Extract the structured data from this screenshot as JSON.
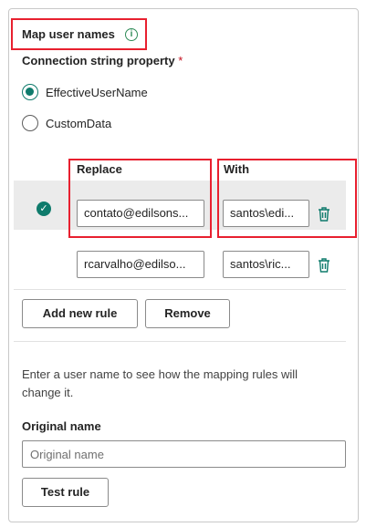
{
  "section": {
    "title": "Map user names",
    "info_icon": "info-icon"
  },
  "connection_property": {
    "label": "Connection string property",
    "required_marker": "*",
    "options": [
      {
        "label": "EffectiveUserName",
        "selected": true
      },
      {
        "label": "CustomData",
        "selected": false
      }
    ]
  },
  "rules_table": {
    "columns": {
      "replace": "Replace",
      "with": "With"
    },
    "rows": [
      {
        "replace": "contato@edilsons...",
        "with": "santos\\edi...",
        "selected": true
      },
      {
        "replace": "rcarvalho@edilso...",
        "with": "santos\\ric...",
        "selected": false
      }
    ]
  },
  "actions": {
    "add_rule": "Add new rule",
    "remove": "Remove"
  },
  "test": {
    "description": "Enter a user name to see how the mapping rules will change it.",
    "original_name_label": "Original name",
    "original_name_placeholder": "Original name",
    "original_name_value": "",
    "test_button": "Test rule"
  },
  "colors": {
    "accent": "#0f7b6c",
    "highlight": "#e8202f",
    "required": "#c50f1f"
  }
}
